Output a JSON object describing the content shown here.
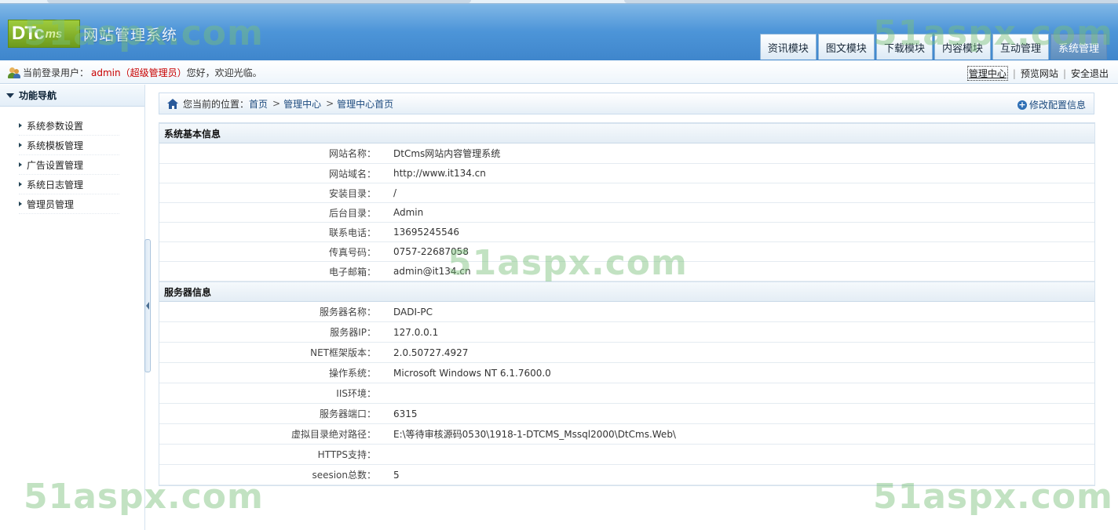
{
  "header": {
    "logo_mark": "DTc",
    "logo_mark_sub": "ms",
    "logo_title": "网站管理系统",
    "tabs": [
      {
        "label": "资讯模块"
      },
      {
        "label": "图文模块"
      },
      {
        "label": "下载模块"
      },
      {
        "label": "内容模块"
      },
      {
        "label": "互动管理"
      },
      {
        "label": "系统管理",
        "active": true
      }
    ]
  },
  "subbar": {
    "prefix": "当前登录用户：",
    "username": "admin",
    "role": "（超级管理员）",
    "greeting": "您好，欢迎光临。",
    "links": [
      "管理中心",
      "预览网站",
      "安全退出"
    ]
  },
  "sidebar": {
    "title": "功能导航",
    "items": [
      {
        "label": "系统参数设置"
      },
      {
        "label": "系统模板管理"
      },
      {
        "label": "广告设置管理"
      },
      {
        "label": "系统日志管理"
      },
      {
        "label": "管理员管理"
      }
    ]
  },
  "breadcrumb": {
    "label": "您当前的位置：",
    "items": [
      "首页",
      "管理中心",
      "管理中心首页"
    ],
    "separator": ">",
    "action": "修改配置信息"
  },
  "sections": {
    "basic": {
      "title": "系统基本信息",
      "rows": [
        {
          "key": "网站名称：",
          "value": "DtCms网站内容管理系统"
        },
        {
          "key": "网站域名：",
          "value": "http://www.it134.cn"
        },
        {
          "key": "安装目录：",
          "value": "/"
        },
        {
          "key": "后台目录：",
          "value": "Admin"
        },
        {
          "key": "联系电话：",
          "value": "13695245546"
        },
        {
          "key": "传真号码：",
          "value": "0757-22687058"
        },
        {
          "key": "电子邮箱：",
          "value": "admin@it134.cn"
        }
      ]
    },
    "server": {
      "title": "服务器信息",
      "rows": [
        {
          "key": "服务器名称：",
          "value": "DADI-PC"
        },
        {
          "key": "服务器IP：",
          "value": "127.0.0.1"
        },
        {
          "key": "NET框架版本：",
          "value": "2.0.50727.4927"
        },
        {
          "key": "操作系统：",
          "value": "Microsoft Windows NT 6.1.7600.0"
        },
        {
          "key": "IIS环境：",
          "value": ""
        },
        {
          "key": "服务器端口：",
          "value": "6315"
        },
        {
          "key": "虚拟目录绝对路径：",
          "value": "E:\\等待审核源码0530\\1918-1-DTCMS_Mssql2000\\DtCms.Web\\"
        },
        {
          "key": "HTTPS支持：",
          "value": ""
        },
        {
          "key": "seesion总数：",
          "value": "5"
        }
      ]
    }
  },
  "watermark": "51aspx.com",
  "colors": {
    "header_blue": "#4d95d8",
    "active_tab": "#6f9ac8",
    "user_red": "#c80000",
    "link_blue": "#1c4a7e",
    "watermark_green": "#78be78"
  }
}
